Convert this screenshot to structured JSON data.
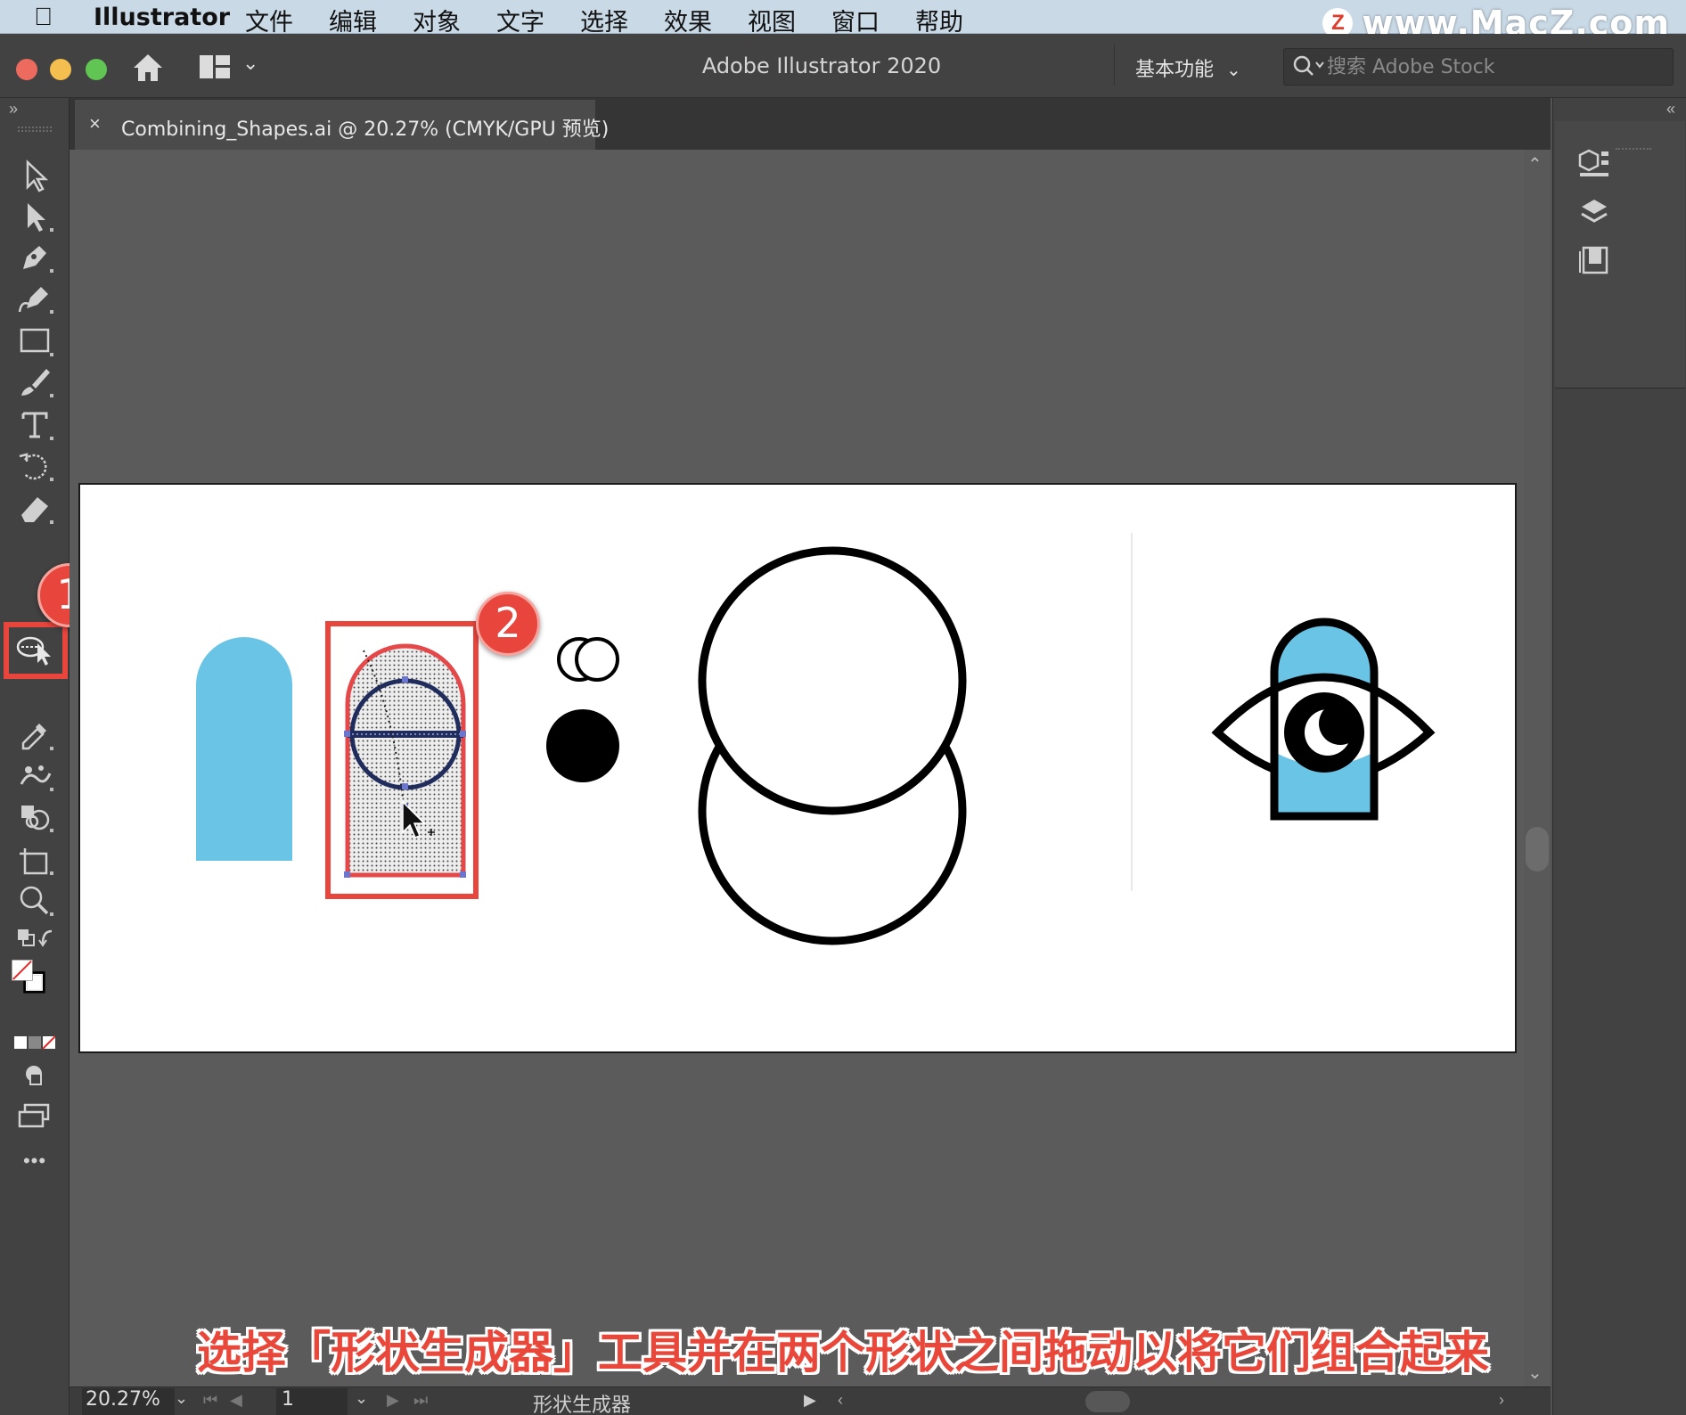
{
  "menubar": {
    "app_name": "Illustrator",
    "items": [
      "文件",
      "编辑",
      "对象",
      "文字",
      "选择",
      "效果",
      "视图",
      "窗口",
      "帮助"
    ]
  },
  "watermark": {
    "logo": "Z",
    "text": "www.MacZ.com"
  },
  "appbar": {
    "title": "Adobe Illustrator 2020",
    "workspace_label": "基本功能",
    "search_placeholder": "搜索 Adobe Stock",
    "traffic_colors": [
      "#ed6a5e",
      "#f5bf4f",
      "#61c554"
    ]
  },
  "document_tab": {
    "close_label": "×",
    "title": "Combining_Shapes.ai @ 20.27% (CMYK/GPU 预览)"
  },
  "toolbar": {
    "tools": [
      "selection-tool",
      "direct-selection-tool",
      "pen-tool",
      "curvature-tool",
      "rectangle-tool",
      "paintbrush-tool",
      "type-tool",
      "rotate-tool",
      "eraser-tool",
      "shape-builder-tool",
      "width-tool",
      "eyedropper-tool",
      "puppet-warp-tool",
      "live-paint-tool",
      "artboard-tool",
      "zoom-tool"
    ],
    "selected_tool": "shape-builder-tool",
    "more_label": "•••"
  },
  "annotations": {
    "badge_1": "1",
    "badge_2": "2",
    "accent_color": "#e8453c"
  },
  "artwork": {
    "fill_blue": "#6ac4e6",
    "stroke_black": "#000000"
  },
  "subtitle": "选择「形状生成器」工具并在两个形状之间拖动以将它们组合起来",
  "statusbar": {
    "zoom": "20.27%",
    "page": "1",
    "tool_name": "形状生成器"
  }
}
